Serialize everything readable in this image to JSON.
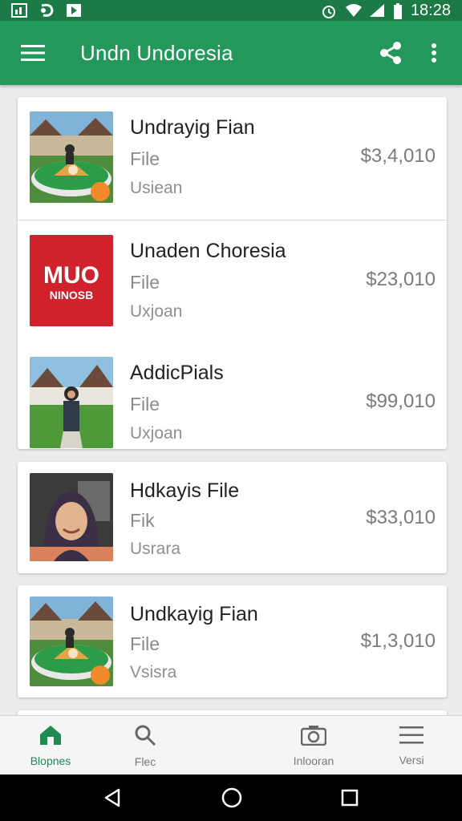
{
  "status_bar": {
    "time": "18:28",
    "icons": [
      "gallery-icon",
      "cast-icon",
      "play-store-icon",
      "alarm-icon",
      "wifi-icon",
      "signal-icon",
      "battery-icon"
    ]
  },
  "app_bar": {
    "title": "Undn Undoresia",
    "icons": [
      "menu-icon",
      "share-icon",
      "more-vert-icon"
    ]
  },
  "cards": [
    {
      "items": [
        {
          "title": "Undrayig Fian",
          "subtitle": "File",
          "meta": "Usiean",
          "price": "$3,4,010",
          "thumb": "food-plate-photo"
        },
        {
          "title": "Unaden Choresia",
          "subtitle": "File",
          "meta": "Uxjoan",
          "price": "$23,010",
          "thumb": "red-logo-image",
          "thumb_text": "MUO",
          "thumb_subtext": "NINOSB"
        },
        {
          "title": "AddicPials",
          "subtitle": "File",
          "meta": "Uxjoan",
          "price": "$99,010",
          "thumb": "person-garden-photo"
        }
      ]
    },
    {
      "items": [
        {
          "title": "Hdkayis File",
          "subtitle": "Fik",
          "meta": "Usrara",
          "price": "$33,010",
          "thumb": "hijab-portrait-photo"
        }
      ]
    },
    {
      "items": [
        {
          "title": "Undkayig Fian",
          "subtitle": "File",
          "meta": "Vsisra",
          "price": "$1,3,010",
          "thumb": "food-plate-photo"
        }
      ]
    }
  ],
  "bottom_nav": {
    "items": [
      {
        "label": "Blopnes",
        "icon": "home-icon",
        "active": true
      },
      {
        "label": "Flec",
        "icon": "search-icon",
        "active": false
      },
      {
        "label": "Inlooran",
        "icon": "camera-icon",
        "active": false
      },
      {
        "label": "Versi",
        "icon": "list-icon",
        "active": false
      }
    ]
  },
  "colors": {
    "status_bar": "#1b7a45",
    "app_bar": "#23985a",
    "accent": "#1f8a52"
  }
}
